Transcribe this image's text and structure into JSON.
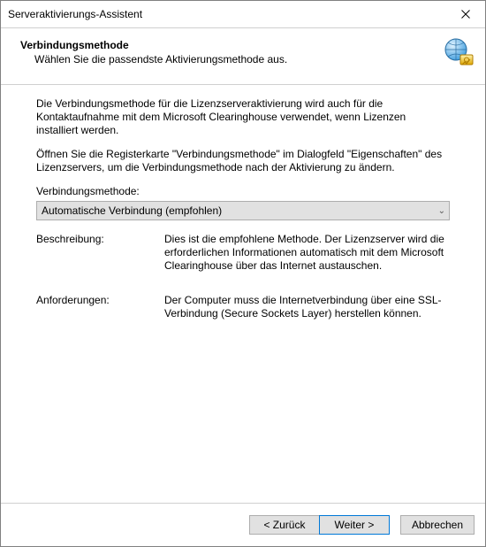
{
  "window": {
    "title": "Serveraktivierungs-Assistent"
  },
  "header": {
    "title": "Verbindungsmethode",
    "subtitle": "Wählen Sie die passendste Aktivierungsmethode aus."
  },
  "body": {
    "para1": "Die Verbindungsmethode für die Lizenzserveraktivierung wird auch für die Kontaktaufnahme mit dem Microsoft Clearinghouse verwendet, wenn Lizenzen installiert werden.",
    "para2": "Öffnen Sie die Registerkarte \"Verbindungsmethode\" im Dialogfeld \"Eigenschaften\" des Lizenzservers, um die Verbindungsmethode nach der Aktivierung zu ändern.",
    "combo_label": "Verbindungsmethode:",
    "combo_value": "Automatische Verbindung (empfohlen)",
    "desc_label": "Beschreibung:",
    "desc_value": "Dies ist die empfohlene Methode. Der Lizenzserver wird die erforderlichen Informationen automatisch mit dem Microsoft Clearinghouse über das Internet austauschen.",
    "req_label": "Anforderungen:",
    "req_value": "Der Computer muss die Internetverbindung über eine SSL-Verbindung (Secure Sockets Layer) herstellen können."
  },
  "footer": {
    "back": "< Zurück",
    "next": "Weiter >",
    "cancel": "Abbrechen"
  }
}
